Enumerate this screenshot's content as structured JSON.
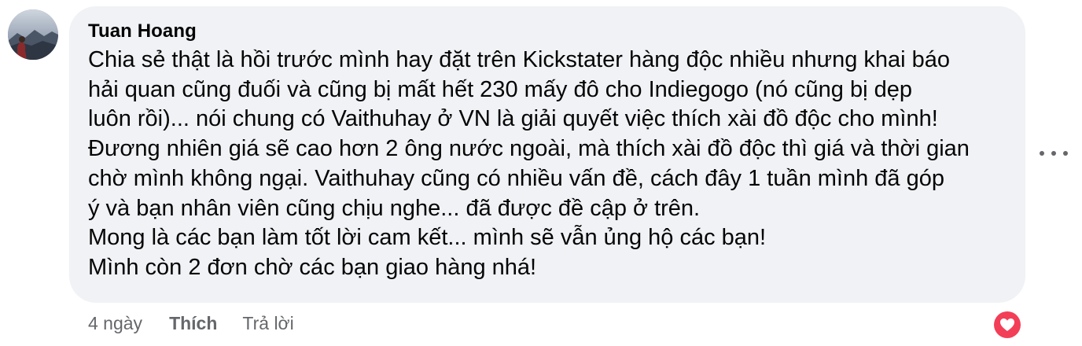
{
  "comment": {
    "author": "Tuan Hoang",
    "lines": [
      "Chia sẻ thật là hồi trước mình hay đặt trên Kickstater hàng độc nhiều nhưng khai báo",
      "hải quan cũng đuối và cũng bị mất hết 230 mấy đô cho Indiegogo (nó cũng bị dẹp",
      "luôn rồi)... nói chung có Vaithuhay ở VN là giải quyết việc thích xài đồ độc cho mình!",
      "Đương nhiên giá sẽ cao hơn 2 ông nước ngoài, mà thích xài đồ độc thì giá và thời gian",
      "chờ mình không ngại. Vaithuhay cũng có nhiều vấn đề, cách đây 1 tuần mình đã góp",
      "ý và bạn nhân viên cũng chịu nghe... đã được đề cập ở trên.",
      "Mong là các bạn làm tốt lời cam kết... mình sẽ vẫn ủng hộ các bạn!",
      "Mình còn 2 đơn chờ các bạn giao hàng nhá!"
    ]
  },
  "actions": {
    "timestamp": "4 ngày",
    "like_label": "Thích",
    "reply_label": "Trả lời"
  },
  "icons": {
    "more": "more-horizontal-icon",
    "reaction": "heart-reaction-icon"
  },
  "colors": {
    "bubble": "#f0f2f5",
    "text": "#050505",
    "secondary": "#65676b",
    "love": "#f33e58"
  }
}
